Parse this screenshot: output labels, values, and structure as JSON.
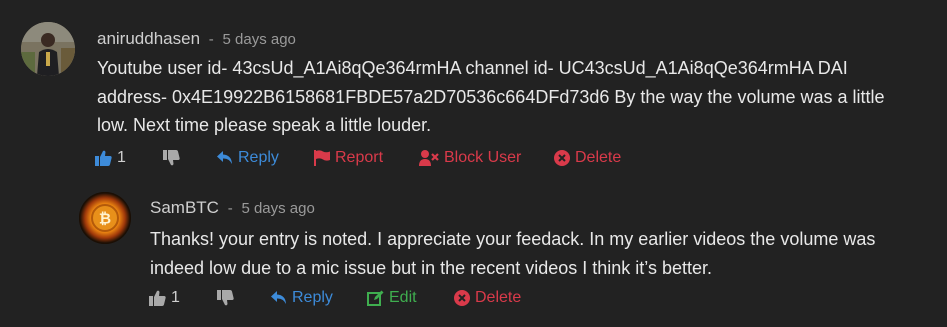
{
  "comments": [
    {
      "author": "aniruddhasen",
      "separator": "-",
      "time": "5 days ago",
      "text": "Youtube user id- 43csUd_A1Ai8qQe364rmHA channel id- UC43csUd_A1Ai8qQe364rmHA DAI address- 0x4E19922B6158681FBDE57a2D70536c664DFd73d6 By the way the volume was a little low. Next time please speak a little louder.",
      "likes": "1",
      "actions": {
        "reply": "Reply",
        "report": "Report",
        "block": "Block User",
        "delete": "Delete"
      },
      "icons": [
        "thumbs-up-icon",
        "thumbs-down-icon",
        "reply-icon",
        "flag-icon",
        "user-x-icon",
        "x-circle-icon"
      ]
    },
    {
      "author": "SamBTC",
      "separator": "-",
      "time": "5 days ago",
      "text": "Thanks! your entry is noted. I appreciate your feedack. In my earlier videos the volume was indeed low due to a mic issue but in the recent videos I think it’s better.",
      "likes": "1",
      "actions": {
        "reply": "Reply",
        "edit": "Edit",
        "delete": "Delete"
      },
      "icons": [
        "thumbs-up-icon",
        "thumbs-down-icon",
        "reply-icon",
        "edit-icon",
        "x-circle-icon"
      ]
    }
  ],
  "colors": {
    "background": "#222222",
    "link": "#3d8bd9",
    "danger": "#d93a4a",
    "edit": "#3fae4f"
  }
}
